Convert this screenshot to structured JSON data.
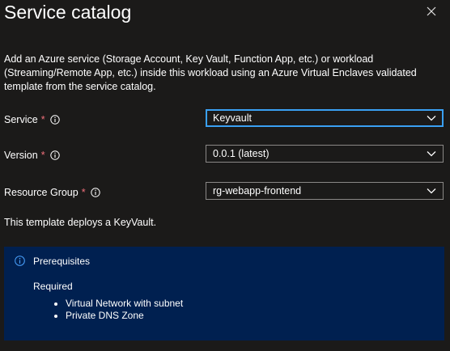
{
  "header": {
    "title": "Service catalog",
    "close_icon": "close-icon"
  },
  "description": "Add an Azure service (Storage Account, Key Vault, Function App, etc.) or workload (Streaming/Remote App, etc.) inside this workload using an Azure Virtual Enclaves validated template from the service catalog.",
  "form": {
    "required_mark": "*",
    "fields": [
      {
        "label": "Service",
        "value": "Keyvault",
        "focused": true
      },
      {
        "label": "Version",
        "value": "0.0.1 (latest)",
        "focused": false
      },
      {
        "label": "Resource Group",
        "value": "rg-webapp-frontend",
        "focused": false
      }
    ]
  },
  "template_note": "This template deploys a KeyVault.",
  "prerequisites": {
    "title": "Prerequisites",
    "subtitle": "Required",
    "items": [
      "Virtual Network with subnet",
      "Private DNS Zone"
    ]
  },
  "colors": {
    "background": "#1b1a19",
    "focus_border": "#3aa0f3",
    "info_box": "#002050",
    "required_star": "#f1707b"
  }
}
